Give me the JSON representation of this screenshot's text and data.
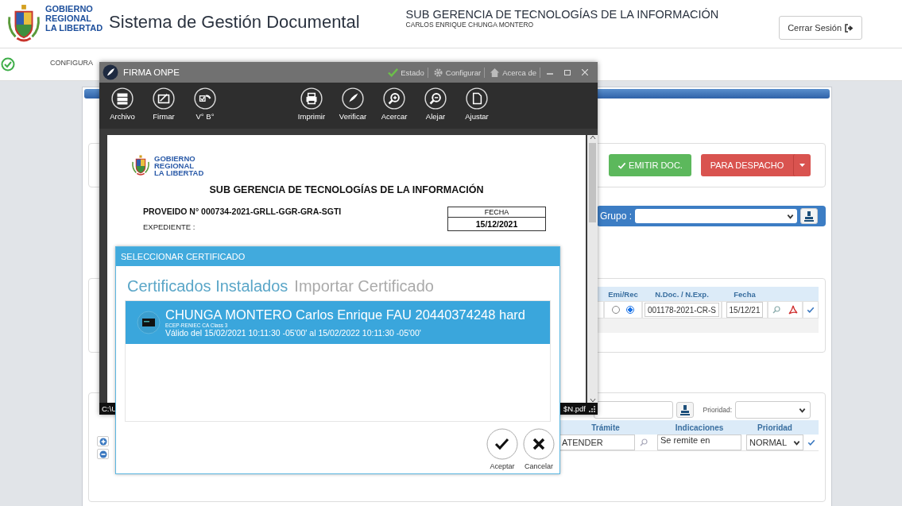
{
  "header": {
    "logo_lines": [
      "GOBIERNO",
      "REGIONAL",
      "LA LIBERTAD"
    ],
    "title": "Sistema de Gestión Documental",
    "department": "SUB GERENCIA DE TECNOLOGÍAS DE LA INFORMACIÓN",
    "user": "CARLOS ENRIQUE CHUNGA MONTERO",
    "logout_button": "Cerrar Sesión"
  },
  "menu": [
    {
      "label": "CONFIGURA"
    }
  ],
  "actions": {
    "emit_button": "EMITIR DOC.",
    "dispatch_button": "PARA DESPACHO"
  },
  "group": {
    "label": "Grupo :"
  },
  "references": {
    "columns": [
      "Emi/Rec",
      "N.Doc. / N.Exp.",
      "Fecha"
    ],
    "rows": [
      {
        "options": [
          {
            "selected": false
          },
          {
            "selected": true
          }
        ],
        "number": "001178-2021-CR-S",
        "date": "15/12/21"
      }
    ]
  },
  "destinations": {
    "priority_label": "Prioridad:",
    "columns": [
      "Trámite",
      "Indicaciones",
      "Prioridad"
    ],
    "rows": [
      {
        "procedure": "ATENDER",
        "instructions": "Se remite en",
        "priority": "NORMAL"
      }
    ]
  },
  "onpe": {
    "title": "FIRMA ONPE",
    "header_links": [
      {
        "label": "Estado",
        "kind": "status"
      },
      {
        "label": "Configurar",
        "kind": "settings"
      },
      {
        "label": "Acerca de",
        "kind": "about"
      }
    ],
    "tool_groups": [
      [
        {
          "label": "Archivo",
          "kind": "archive"
        },
        {
          "label": "Firmar",
          "kind": "sign"
        },
        {
          "label": "V° B°",
          "kind": "approve"
        }
      ],
      [
        {
          "label": "Imprimir",
          "kind": "print"
        },
        {
          "label": "Verificar",
          "kind": "verify"
        },
        {
          "label": "Acercar",
          "kind": "zoom_in"
        },
        {
          "label": "Alejar",
          "kind": "zoom_out"
        },
        {
          "label": "Ajustar",
          "kind": "fit"
        }
      ]
    ],
    "document": {
      "logo_lines": [
        "GOBIERNO",
        "REGIONAL",
        "LA LIBERTAD"
      ],
      "heading": "SUB GERENCIA DE TECNOLOGÍAS DE LA INFORMACIÓN",
      "reference": "PROVEIDO N° 000734-2021-GRLL-GGR-GRA-SGTI",
      "file_label": "EXPEDIENTE :",
      "date_label": "FECHA",
      "date": "15/12/2021"
    },
    "status_left": "C:\\U",
    "status_right": "$N.pdf"
  },
  "certificate_dialog": {
    "title": "SELECCIONAR CERTIFICADO",
    "tabs": [
      {
        "label": "Certificados Instalados",
        "selected": true
      },
      {
        "label": "Importar Certificado",
        "selected": false
      }
    ],
    "certificates": [
      {
        "name": "CHUNGA MONTERO Carlos Enrique FAU 20440374248 hard",
        "issuer": "ECEP-RENIEC CA Class 3",
        "validity": "Válido del 15/02/2021 10:11:30 -05'00' al 15/02/2022 10:11:30 -05'00'",
        "selected": true
      }
    ],
    "buttons": [
      {
        "label": "Aceptar",
        "kind": "accept"
      },
      {
        "label": "Cancelar",
        "kind": "cancel"
      }
    ]
  }
}
